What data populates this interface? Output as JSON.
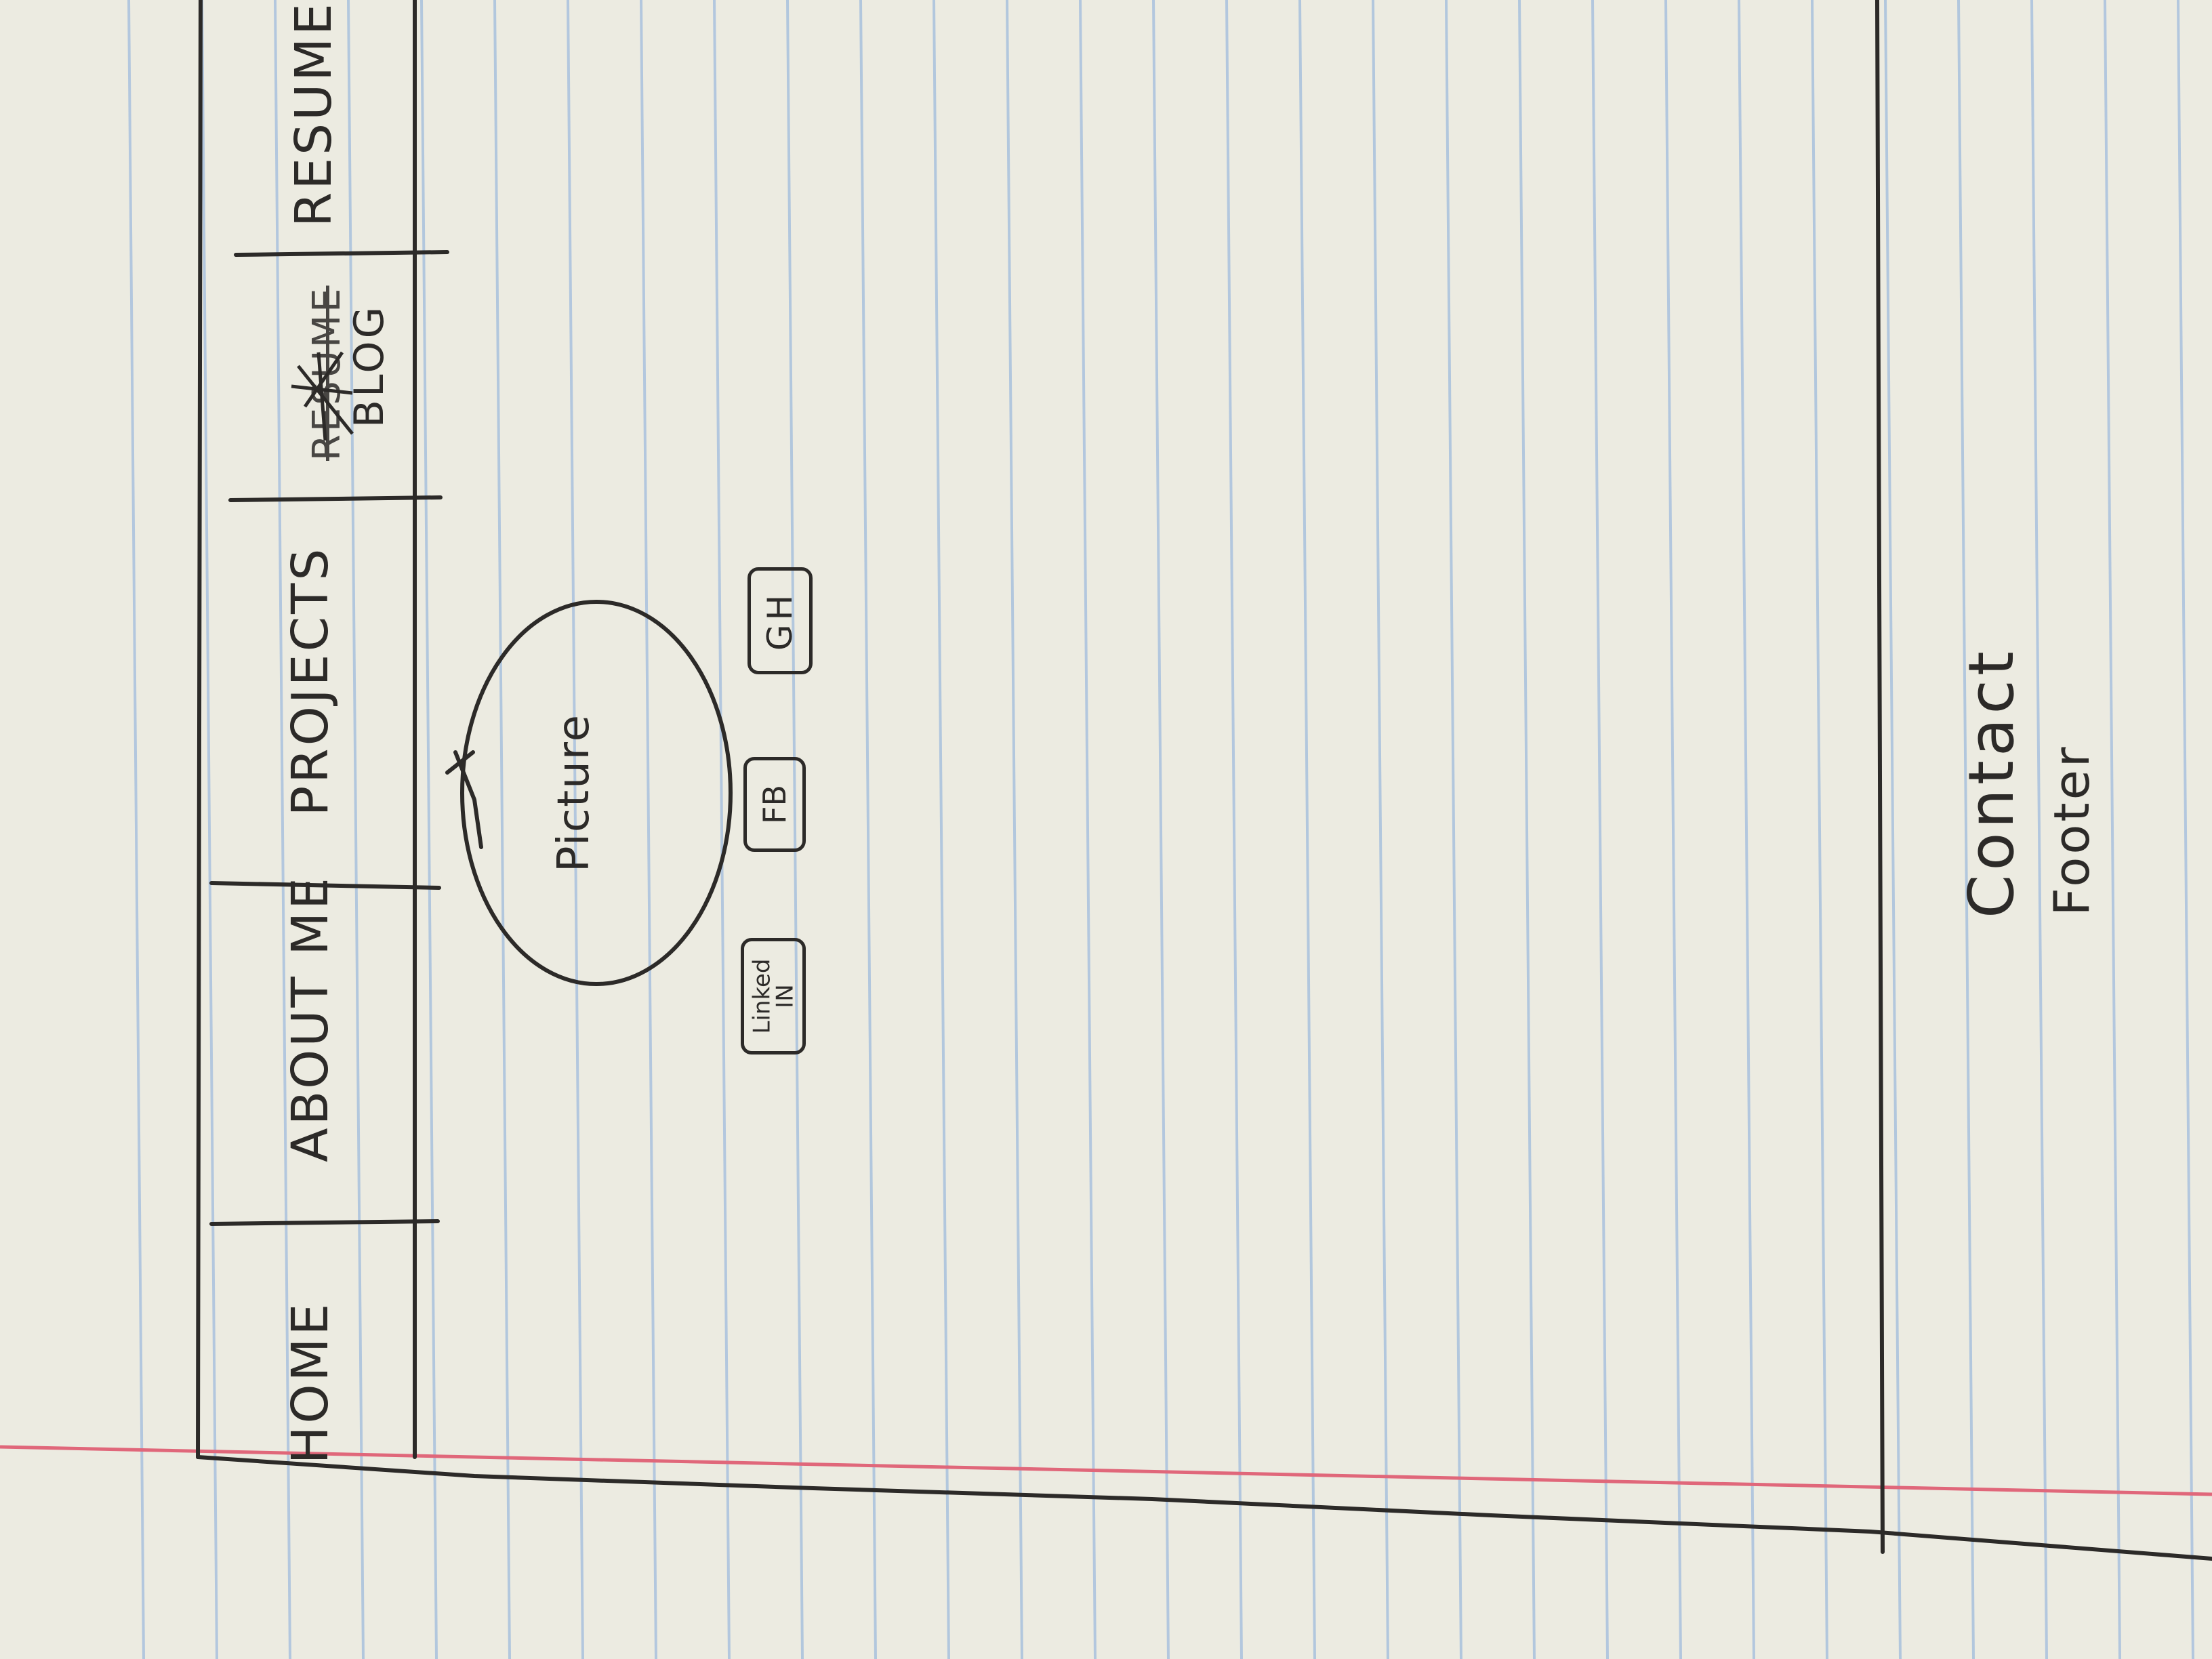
{
  "nav": {
    "items": [
      {
        "label": "HOME"
      },
      {
        "label": "ABOUT ME"
      },
      {
        "label": "PROJECTS"
      },
      {
        "label": "RESUME",
        "struck": true
      },
      {
        "label": "BLOG"
      },
      {
        "label": "RESUME"
      }
    ]
  },
  "hero": {
    "picture_label": "Picture"
  },
  "social": {
    "linkedin_line1": "Linked",
    "linkedin_line2": "IN",
    "facebook": "FB",
    "github": "GH"
  },
  "footer": {
    "contact": "Contact",
    "label": "Footer"
  },
  "colors": {
    "paper": "#ecebe1",
    "rule_blue": "#a9c1dd",
    "margin_red": "#e0677a",
    "ink": "#2c2a28"
  }
}
